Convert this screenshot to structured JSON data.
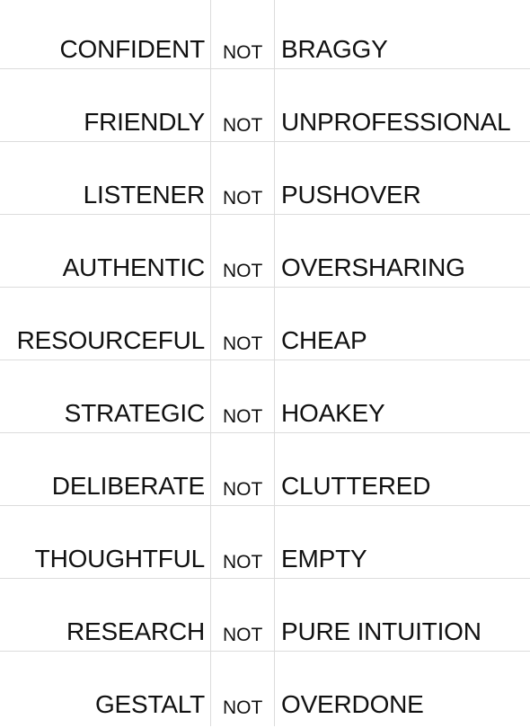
{
  "rows": [
    {
      "left": "CONFIDENT",
      "mid": "NOT",
      "right": "BRAGGY"
    },
    {
      "left": "FRIENDLY",
      "mid": "NOT",
      "right": "UNPROFESSIONAL"
    },
    {
      "left": "LISTENER",
      "mid": "NOT",
      "right": "PUSHOVER"
    },
    {
      "left": "AUTHENTIC",
      "mid": "NOT",
      "right": "OVERSHARING"
    },
    {
      "left": "RESOURCEFUL",
      "mid": "NOT",
      "right": "CHEAP"
    },
    {
      "left": "STRATEGIC",
      "mid": "NOT",
      "right": "HOAKEY"
    },
    {
      "left": "DELIBERATE",
      "mid": "NOT",
      "right": "CLUTTERED"
    },
    {
      "left": "THOUGHTFUL",
      "mid": "NOT",
      "right": "EMPTY"
    },
    {
      "left": "RESEARCH",
      "mid": "NOT",
      "right": "PURE INTUITION"
    },
    {
      "left": "GESTALT",
      "mid": "NOT",
      "right": "OVERDONE"
    }
  ]
}
